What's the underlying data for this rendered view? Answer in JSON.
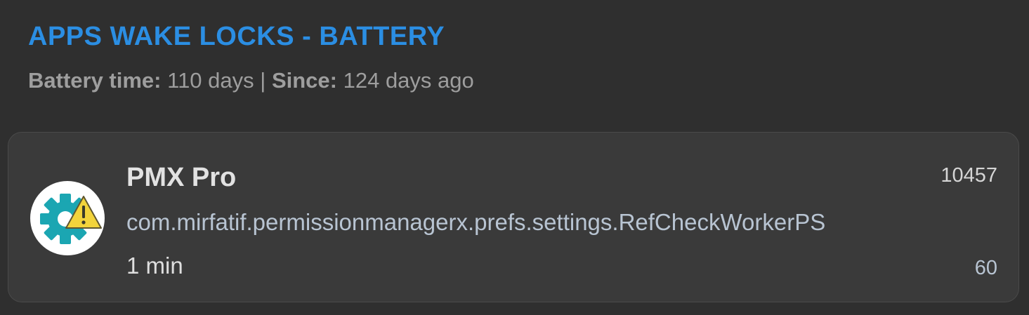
{
  "header": {
    "title": "APPS WAKE LOCKS - BATTERY",
    "battery_time_label": "Battery time:",
    "battery_time_value": "110 days",
    "separator": "|",
    "since_label": "Since:",
    "since_value": "124 days ago"
  },
  "wakelock_item": {
    "icon": "gear-warning-icon",
    "app_name": "PMX Pro",
    "uid": "10457",
    "tag": "com.mirfatif.permissionmanagerx.prefs.settings.RefCheckWorkerPS",
    "duration": "1 min",
    "count": "60"
  },
  "colors": {
    "background": "#2f2f2f",
    "card": "#3a3a3a",
    "accent": "#2b8ee3",
    "icon_gear": "#1ba6b2",
    "icon_warning": "#f2d33b"
  }
}
